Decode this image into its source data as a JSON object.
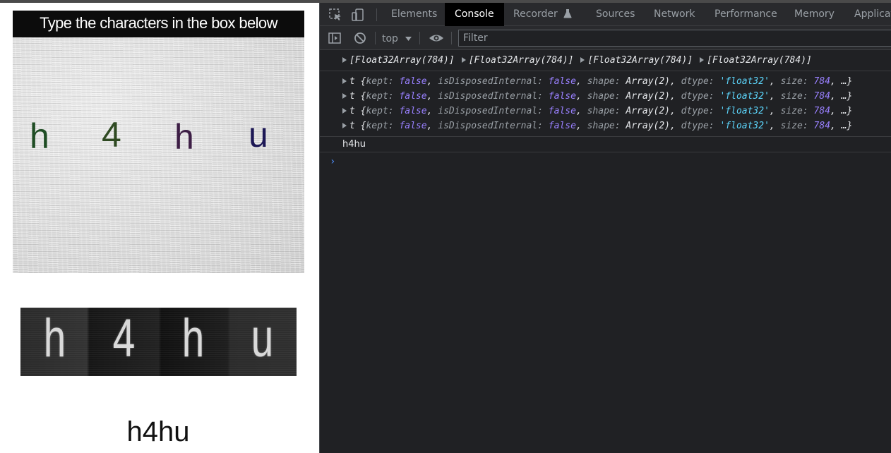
{
  "page": {
    "captcha_title": "Type the characters in the box below",
    "captcha_chars": [
      {
        "char": "h",
        "color": "#1f4d24"
      },
      {
        "char": "4",
        "color": "#2f4a22"
      },
      {
        "char": "h",
        "color": "#3d1e45"
      },
      {
        "char": "u",
        "color": "#1c1755"
      }
    ],
    "processed_chars": [
      "h",
      "4",
      "h",
      "u"
    ],
    "result_text": "h4hu"
  },
  "devtools": {
    "tabs": [
      "Elements",
      "Console",
      "Recorder",
      "Sources",
      "Network",
      "Performance",
      "Memory",
      "Applicat"
    ],
    "active_tab": "Console",
    "recorder_icon": "flask-icon",
    "context": "top",
    "filter_placeholder": "Filter",
    "console": {
      "float_arrays": [
        "[Float32Array(784)]",
        "[Float32Array(784)]",
        "[Float32Array(784)]",
        "[Float32Array(784)]"
      ],
      "tensor_lines": [
        {
          "prefix": "t {",
          "kept_key": "kept: ",
          "kept": "false",
          "disp_key": "isDisposedInternal: ",
          "disp": "false",
          "shape_key": "shape: ",
          "shape": "Array(2)",
          "dtype_key": "dtype: ",
          "dtype": "'float32'",
          "size_key": "size: ",
          "size": "784",
          "suffix": ", …}"
        },
        {
          "prefix": "t {",
          "kept_key": "kept: ",
          "kept": "false",
          "disp_key": "isDisposedInternal: ",
          "disp": "false",
          "shape_key": "shape: ",
          "shape": "Array(2)",
          "dtype_key": "dtype: ",
          "dtype": "'float32'",
          "size_key": "size: ",
          "size": "784",
          "suffix": ", …}"
        },
        {
          "prefix": "t {",
          "kept_key": "kept: ",
          "kept": "false",
          "disp_key": "isDisposedInternal: ",
          "disp": "false",
          "shape_key": "shape: ",
          "shape": "Array(2)",
          "dtype_key": "dtype: ",
          "dtype": "'float32'",
          "size_key": "size: ",
          "size": "784",
          "suffix": ", …}"
        },
        {
          "prefix": "t {",
          "kept_key": "kept: ",
          "kept": "false",
          "disp_key": "isDisposedInternal: ",
          "disp": "false",
          "shape_key": "shape: ",
          "shape": "Array(2)",
          "dtype_key": "dtype: ",
          "dtype": "'float32'",
          "size_key": "size: ",
          "size": "784",
          "suffix": ", …}"
        }
      ],
      "output_text": "h4hu",
      "prompt_symbol": "›"
    }
  }
}
